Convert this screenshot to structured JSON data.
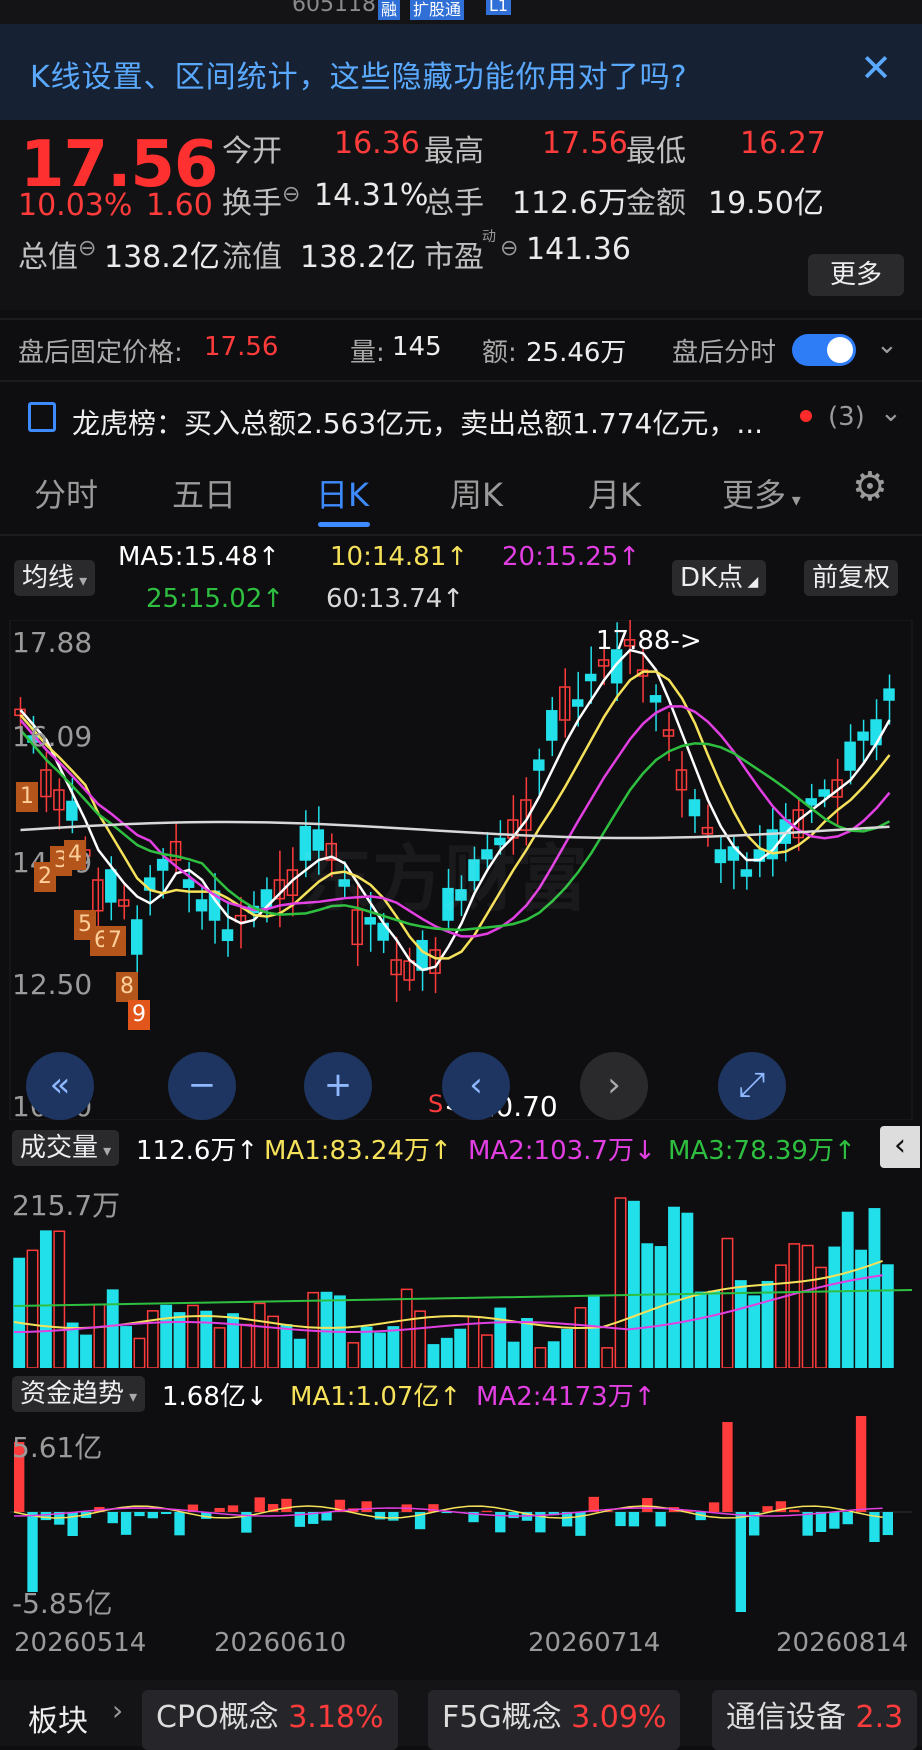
{
  "header": {
    "code": "605118",
    "badges": [
      "融",
      "扩股通",
      "L1"
    ]
  },
  "banner": {
    "text": "K线设置、区间统计，这些隐藏功能你用对了吗?",
    "close": "✕"
  },
  "quote": {
    "price": "17.56",
    "change_pct": "10.03%",
    "change": "1.60",
    "open_label": "今开",
    "open": "16.36",
    "high_label": "最高",
    "high": "17.56",
    "low_label": "最低",
    "low": "16.27",
    "turnover_label": "换手",
    "turnover": "14.31%",
    "volume_label": "总手",
    "volume": "112.6万",
    "amount_label": "金额",
    "amount": "19.50亿",
    "mktcap_label": "总值",
    "mktcap": "138.2亿",
    "float_label": "流值",
    "float": "138.2亿",
    "pe_label": "市盈",
    "pe_sup": "动",
    "pe": "141.36",
    "more": "更多"
  },
  "after_hours": {
    "label": "盘后固定价格:",
    "price": "17.56",
    "vol_label": "量:",
    "vol": "145",
    "amt_label": "额:",
    "amt": "25.46万",
    "timeshare": "盘后分时"
  },
  "dragon": {
    "text": "龙虎榜：买入总额2.563亿元，卖出总额1.774亿元，...",
    "count": "(3)"
  },
  "tabs": [
    "分时",
    "五日",
    "日K",
    "周K",
    "月K",
    "更多"
  ],
  "ma": {
    "selector": "均线",
    "ma5": "MA5:15.48↑",
    "ma10": "10:14.81↑",
    "ma20": "20:15.25↑",
    "ma25": "25:15.02↑",
    "ma60": "60:13.74↑",
    "dk": "DK点",
    "fq": "前复权"
  },
  "kline": {
    "y_top": "17.88",
    "y_2": "16.09",
    "y_3": "14.29",
    "y_4": "12.50",
    "y_bottom": "10.70",
    "max_note": "17.88->",
    "min_note": "<-10.70",
    "s_mark": "S",
    "tds": [
      "1",
      "2",
      "3",
      "4",
      "5",
      "6",
      "7",
      "8",
      "9"
    ]
  },
  "volume": {
    "selector": "成交量",
    "val": "112.6万↑",
    "ma1": "MA1:83.24万↑",
    "ma2": "MA2:103.7万↓",
    "ma3": "MA3:78.39万↑",
    "ymax": "215.7万"
  },
  "fund": {
    "selector": "资金趋势",
    "val": "1.68亿↓",
    "ma1": "MA1:1.07亿↑",
    "ma2": "MA2:4173万↑",
    "ymax": "5.61亿",
    "ymin": "-5.85亿"
  },
  "dates": [
    "20260514",
    "20260610",
    "20260714",
    "20260814"
  ],
  "bottom": {
    "label": "板块",
    "chips": [
      {
        "name": "CPO概念",
        "pct": "3.18%"
      },
      {
        "name": "F5G概念",
        "pct": "3.09%"
      },
      {
        "name": "通信设备",
        "pct": "2.3"
      }
    ]
  },
  "colors": {
    "up": "#ff3b3b",
    "down": "#22e0ea",
    "ma5": "#ffffff",
    "ma10": "#f5e15a",
    "ma20": "#e23fe2",
    "ma25": "#2fbf40",
    "ma60": "#d8d8d8",
    "accent": "#3d8bff"
  }
}
